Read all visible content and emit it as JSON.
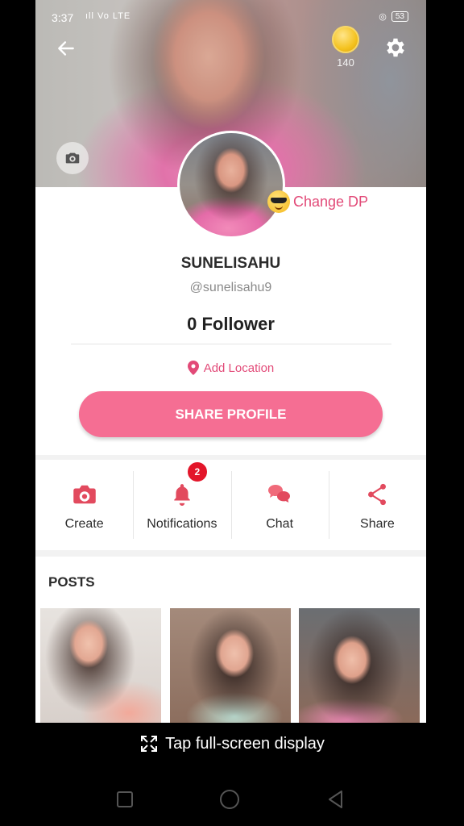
{
  "status_bar": {
    "time": "3:37",
    "signal": "ıll Vo LTE",
    "battery": "53"
  },
  "header": {
    "coins": "140"
  },
  "profile": {
    "change_dp_label": "Change DP",
    "name": "SUNELISAHU",
    "handle": "@sunelisahu9",
    "followers": "0 Follower",
    "add_location_label": "Add Location",
    "share_profile_label": "SHARE PROFILE"
  },
  "actions": [
    {
      "label": "Create",
      "icon": "camera-icon"
    },
    {
      "label": "Notifications",
      "icon": "bell-icon",
      "badge": "2"
    },
    {
      "label": "Chat",
      "icon": "chat-bubbles-icon"
    },
    {
      "label": "Share",
      "icon": "share-icon"
    }
  ],
  "posts": {
    "title": "POSTS",
    "count_visible": 3
  },
  "overlay": {
    "fullscreen_tip": "Tap full-screen display"
  },
  "colors": {
    "accent": "#e24a78",
    "button": "#f56e93",
    "badge": "#e3162a",
    "background": "#000000"
  }
}
